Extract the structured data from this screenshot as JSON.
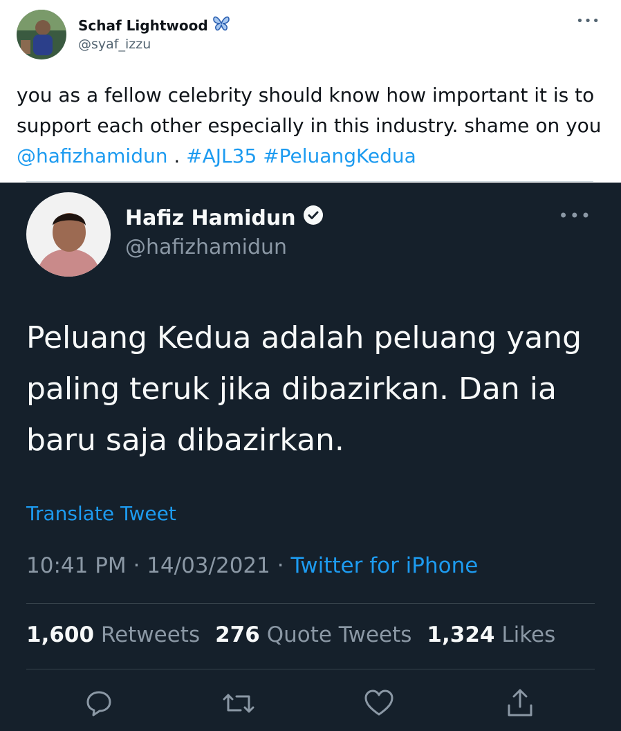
{
  "quote_tweet": {
    "author_name": "Schaf Lightwood",
    "badge_icon": "butterfly-icon",
    "handle": "@syaf_izzu",
    "more": "•••",
    "text_plain": "you as a fellow celebrity should know how important it is to support each other especially in this industry. shame on you ",
    "mention": "@hafizhamidun",
    "text_sep": " . ",
    "hashtag1": "#AJL35",
    "hashtag2": "#PeluangKedua"
  },
  "embedded_tweet": {
    "author_name": "Hafiz Hamidun",
    "verified_icon": "verified-badge-icon",
    "handle": "@hafizhamidun",
    "more": "•••",
    "text": "Peluang Kedua adalah peluang yang paling teruk jika dibazirkan. Dan ia baru saja dibazirkan.",
    "translate_label": "Translate Tweet",
    "time": "10:41 PM · 14/03/2021 · ",
    "source": "Twitter for iPhone",
    "stats": {
      "retweets_count": "1,600",
      "retweets_label": "Retweets",
      "quotes_count": "276",
      "quotes_label": "Quote Tweets",
      "likes_count": "1,324",
      "likes_label": "Likes"
    },
    "actions": [
      "reply-icon",
      "retweet-icon",
      "like-icon",
      "share-icon"
    ]
  },
  "colors": {
    "link": "#1d9bf0",
    "dark_bg": "#15202b",
    "muted": "#8b98a5"
  }
}
